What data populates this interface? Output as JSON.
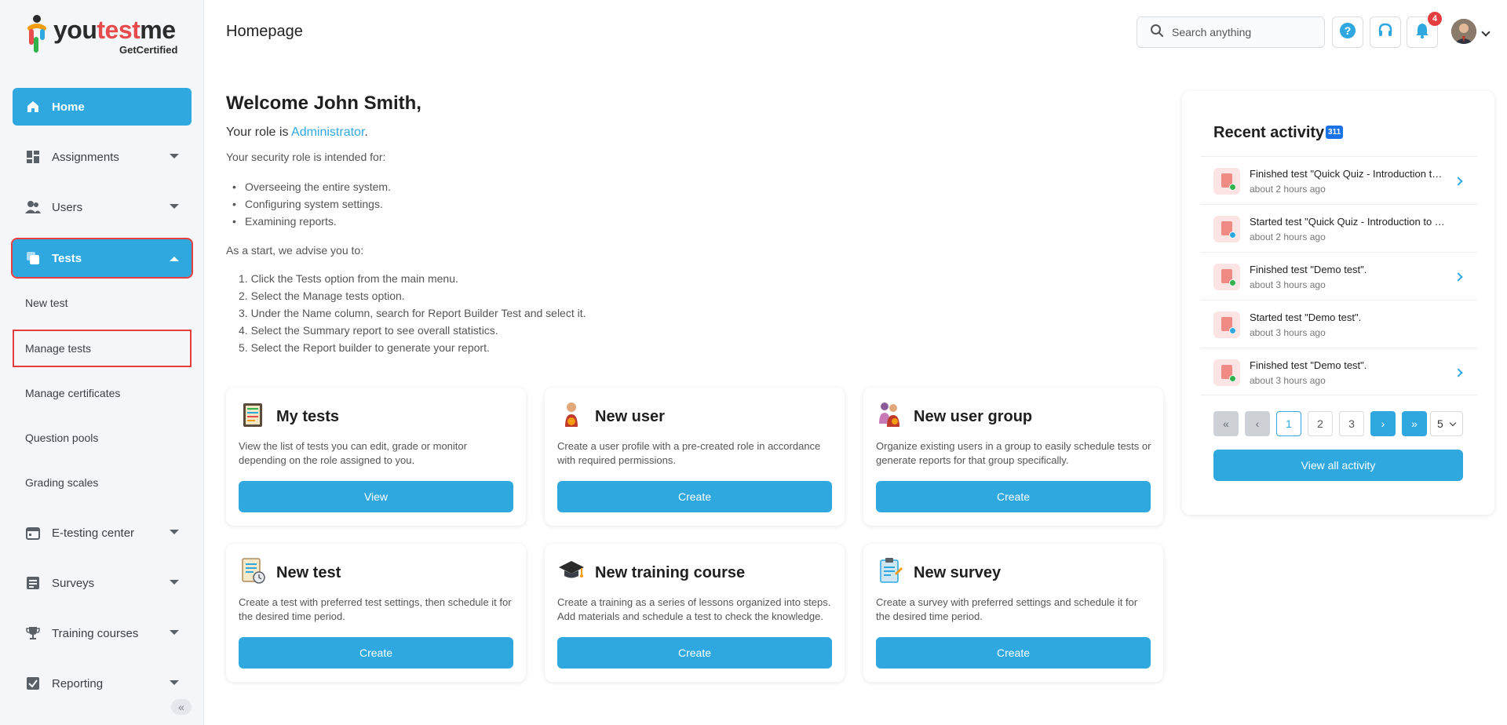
{
  "brand": {
    "name_part1": "you",
    "name_accent": "test",
    "name_part2": "me",
    "tagline": "GetCertified"
  },
  "header": {
    "title": "Homepage",
    "search_placeholder": "Search anything",
    "notifications_count": "4"
  },
  "sidebar": {
    "items": [
      {
        "label": "Home",
        "icon": "home-icon"
      },
      {
        "label": "Assignments",
        "icon": "dashboard-icon"
      },
      {
        "label": "Users",
        "icon": "users-icon"
      },
      {
        "label": "Tests",
        "icon": "tests-icon"
      },
      {
        "label": "E-testing center",
        "icon": "calendar-icon"
      },
      {
        "label": "Surveys",
        "icon": "list-icon"
      },
      {
        "label": "Training courses",
        "icon": "trophy-icon"
      },
      {
        "label": "Reporting",
        "icon": "report-icon"
      }
    ],
    "tests_sub": [
      "New test",
      "Manage tests",
      "Manage certificates",
      "Question pools",
      "Grading scales"
    ]
  },
  "welcome": {
    "greeting": "Welcome John Smith,",
    "role_prefix": "Your role is ",
    "role": "Administrator",
    "role_suffix": ".",
    "intended": "Your security role is intended for:",
    "bullets": [
      "Overseeing the entire system.",
      "Configuring system settings.",
      "Examining reports."
    ],
    "advise": "As a start, we advise you to:",
    "steps": [
      "1. Click the Tests option from the main menu.",
      "2. Select the Manage tests option.",
      "3. Under the Name column, search for Report Builder Test and select it.",
      "4. Select the Summary report to see overall statistics.",
      "5. Select the Report builder to generate your report."
    ]
  },
  "cards": [
    {
      "title": "My tests",
      "desc": "View the list of tests you can edit, grade or monitor depending on the role assigned to you.",
      "button": "View",
      "icon": "my-tests-icon"
    },
    {
      "title": "New user",
      "desc": "Create a user profile with a pre-created role in accordance with required permissions.",
      "button": "Create",
      "icon": "new-user-icon"
    },
    {
      "title": "New user group",
      "desc": "Organize existing users in a group to easily schedule tests or generate reports for that group specifically.",
      "button": "Create",
      "icon": "new-user-group-icon"
    },
    {
      "title": "New test",
      "desc": "Create a test with preferred test settings, then schedule it for the desired time period.",
      "button": "Create",
      "icon": "new-test-icon"
    },
    {
      "title": "New training course",
      "desc": "Create a training as a series of lessons organized into steps. Add materials and schedule a test to check the knowledge.",
      "button": "Create",
      "icon": "graduation-cap-icon"
    },
    {
      "title": "New survey",
      "desc": "Create a survey with preferred settings and schedule it for the desired time period.",
      "button": "Create",
      "icon": "clipboard-icon"
    }
  ],
  "recent": {
    "title": "Recent activity",
    "count": "311",
    "items": [
      {
        "text": "Finished test \"Quick Quiz - Introduction to Testing\".",
        "time": "about 2 hours ago",
        "status": "finished"
      },
      {
        "text": "Started test \"Quick Quiz - Introduction to Testing\".",
        "time": "about 2 hours ago",
        "status": "started"
      },
      {
        "text": "Finished test \"Demo test\".",
        "time": "about 3 hours ago",
        "status": "finished"
      },
      {
        "text": "Started test \"Demo test\".",
        "time": "about 3 hours ago",
        "status": "started"
      },
      {
        "text": "Finished test \"Demo test\".",
        "time": "about 3 hours ago",
        "status": "finished"
      }
    ],
    "pages": [
      "1",
      "2",
      "3"
    ],
    "page_size": "5",
    "view_all": "View all activity"
  },
  "colors": {
    "accent": "#2fa8e0",
    "highlight": "#e53e3e",
    "finished": "#2fb34a",
    "started": "#2fa8e0"
  }
}
